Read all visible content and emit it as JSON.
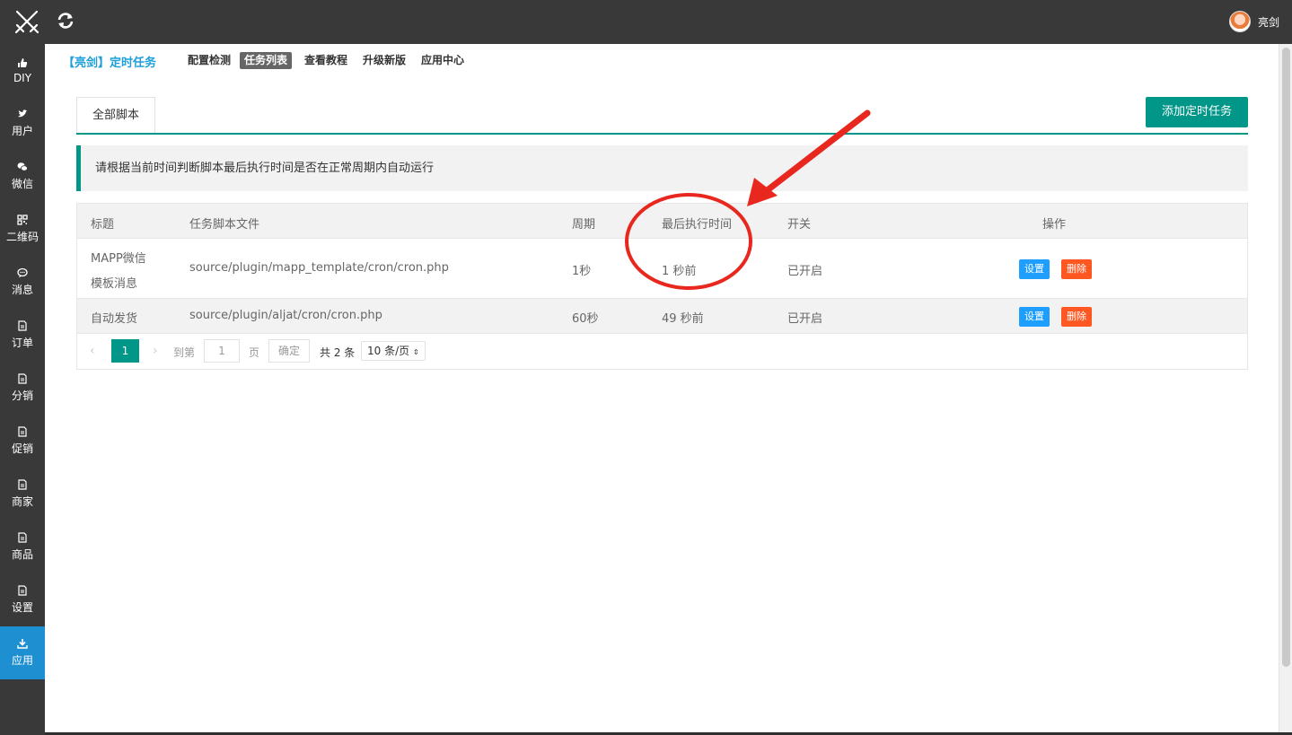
{
  "topbar": {
    "logo_icon": "crossed-swords-icon",
    "refresh_icon": "refresh-icon",
    "username": "亮剑"
  },
  "sidebar": {
    "items": [
      {
        "label": "DIY",
        "icon": "thumbs-up-icon",
        "active": false
      },
      {
        "label": "用户",
        "icon": "twitter-bird-icon",
        "active": false
      },
      {
        "label": "微信",
        "icon": "wechat-icon",
        "active": false
      },
      {
        "label": "二维码",
        "icon": "qrcode-icon",
        "active": false
      },
      {
        "label": "消息",
        "icon": "chat-bubble-icon",
        "active": false
      },
      {
        "label": "订单",
        "icon": "document-icon",
        "active": false
      },
      {
        "label": "分销",
        "icon": "document-icon",
        "active": false
      },
      {
        "label": "促销",
        "icon": "document-icon",
        "active": false
      },
      {
        "label": "商家",
        "icon": "document-icon",
        "active": false
      },
      {
        "label": "商品",
        "icon": "document-icon",
        "active": false
      },
      {
        "label": "设置",
        "icon": "document-icon",
        "active": false
      },
      {
        "label": "应用",
        "icon": "download-icon",
        "active": true
      }
    ]
  },
  "subnav": {
    "brand": "【亮剑】定时任务",
    "links": [
      "配置检测",
      "任务列表",
      "查看教程",
      "升级新版",
      "应用中心"
    ],
    "active_index": 1
  },
  "tabs": {
    "all_scripts": "全部脚本"
  },
  "actions": {
    "add_task": "添加定时任务"
  },
  "tip": "请根据当前时间判断脚本最后执行时间是否在正常周期内自动运行",
  "table": {
    "headers": [
      "标题",
      "任务脚本文件",
      "周期",
      "最后执行时间",
      "开关",
      "操作"
    ],
    "rows": [
      {
        "title_line1": "MAPP微信",
        "title_line2": "模板消息",
        "file": "source/plugin/mapp_template/cron/cron.php",
        "period": "1秒",
        "last_run": "1 秒前",
        "status": "已开启",
        "edit": "设置",
        "delete": "删除"
      },
      {
        "title": "自动发货",
        "file": "source/plugin/aljat/cron/cron.php",
        "period": "60秒",
        "last_run": "49 秒前",
        "status": "已开启",
        "edit": "设置",
        "delete": "删除"
      }
    ]
  },
  "pager": {
    "current_page": "1",
    "goto_label": "到第",
    "goto_value": "1",
    "page_label": "页",
    "confirm": "确定",
    "total": "共 2 条",
    "page_size": "10 条/页"
  },
  "colors": {
    "accent": "#009688",
    "brand_blue": "#1e9fd9",
    "edit_blue": "#1e9fff",
    "delete_orange": "#ff5722",
    "annotation_red": "#e8281e"
  }
}
